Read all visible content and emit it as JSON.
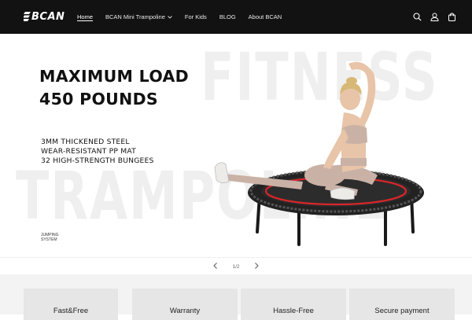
{
  "brand": {
    "logo_text": "BCAN"
  },
  "nav": [
    {
      "label": "Home",
      "active": true,
      "dropdown": false
    },
    {
      "label": "BCAN Mini Trampoline",
      "active": false,
      "dropdown": true
    },
    {
      "label": "For Kids",
      "active": false,
      "dropdown": false
    },
    {
      "label": "BLOG",
      "active": false,
      "dropdown": false
    },
    {
      "label": "About BCAN",
      "active": false,
      "dropdown": false
    }
  ],
  "header_icons": [
    "search-icon",
    "account-icon",
    "cart-icon"
  ],
  "hero": {
    "headline_line1": "MAXIMUM LOAD",
    "headline_line2": "450 POUNDS",
    "feature_1": "3MM THICKENED STEEL",
    "feature_2": "WEAR-RESISTANT PP MAT",
    "feature_3": "32 HIGH-STRENGTH BUNGEES",
    "bg_word_1": "FITNESS",
    "bg_word_2": "TRAMPOLINE",
    "caption_line1": "JUMPING",
    "caption_line2": "SYSTEM"
  },
  "slider": {
    "counter": "1/2"
  },
  "benefits": [
    {
      "title": "Fast&Free"
    },
    {
      "title": "Warranty"
    },
    {
      "title": "Hassle-Free"
    },
    {
      "title": "Secure payment"
    }
  ],
  "colors": {
    "header_bg": "#121212",
    "trampoline_accent": "#d9262b",
    "bg_watermark": "#efefef"
  }
}
